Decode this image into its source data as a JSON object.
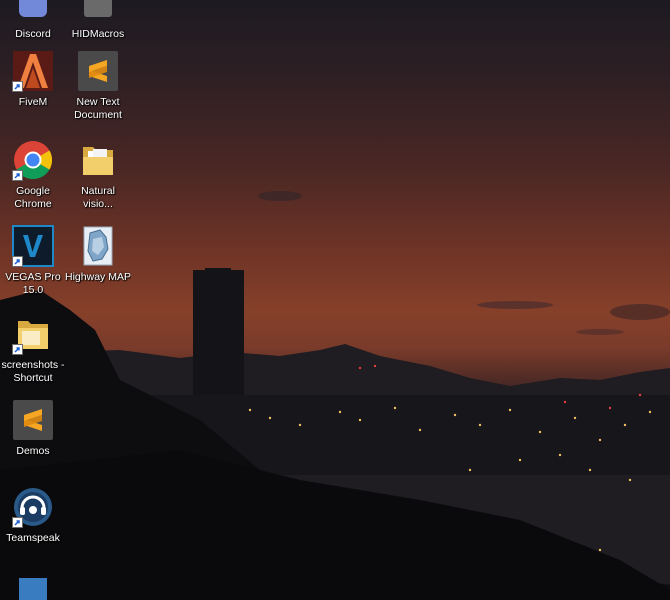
{
  "desktop": {
    "icons": [
      {
        "label": "Discord",
        "icon": "discord-icon"
      },
      {
        "label": "HIDMacros",
        "icon": "hidmacros-icon"
      },
      {
        "label": "FiveM",
        "icon": "fivem-icon"
      },
      {
        "label": "New Text Document",
        "icon": "sublime-text-icon"
      },
      {
        "label": "Google Chrome",
        "icon": "chrome-icon"
      },
      {
        "label": "Natural visio...",
        "icon": "folder-icon"
      },
      {
        "label": "VEGAS Pro 15.0",
        "icon": "vegas-pro-icon"
      },
      {
        "label": "Highway MAP",
        "icon": "map-icon"
      },
      {
        "label": "screenshots - Shortcut",
        "icon": "folder-shortcut-icon"
      },
      {
        "label": "Demos",
        "icon": "sublime-text-icon"
      },
      {
        "label": "Teamspeak",
        "icon": "teamspeak-icon"
      },
      {
        "label": "",
        "icon": "partial-icon"
      }
    ]
  },
  "colors": {
    "sky_top": "#1d1a22",
    "sky_glow": "#86402a",
    "ground": "#121216",
    "sublime_orange": "#f5a623",
    "vegas_blue": "#1e88c8"
  }
}
